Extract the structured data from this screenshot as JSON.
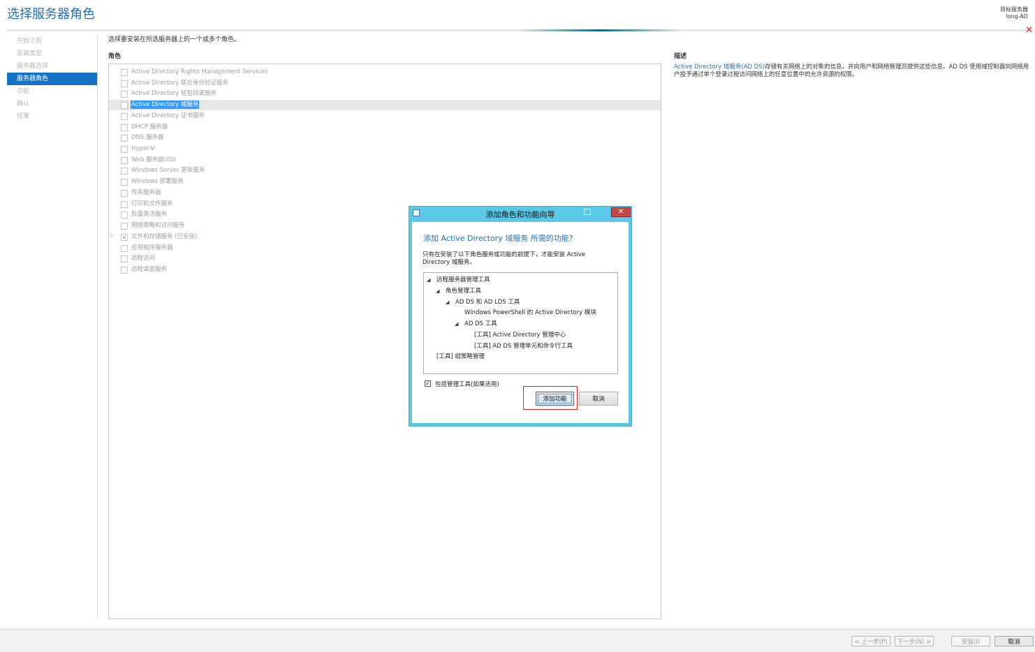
{
  "page": {
    "title": "选择服务器角色",
    "server_label": "目标服务器",
    "server_name": "long-AD",
    "close_glyph": "✕",
    "accent": "#1572c5"
  },
  "nav": {
    "items": [
      {
        "label": "开始之前",
        "active": false
      },
      {
        "label": "安装类型",
        "active": false
      },
      {
        "label": "服务器选择",
        "active": false
      },
      {
        "label": "服务器角色",
        "active": true
      },
      {
        "label": "功能",
        "active": false
      },
      {
        "label": "确认",
        "active": false
      },
      {
        "label": "结果",
        "active": false
      }
    ]
  },
  "main": {
    "instruction": "选择要安装在所选服务器上的一个或多个角色。",
    "roles_header": "角色",
    "roles": [
      "Active Directory Rights Management Services",
      "Active Directory 联合身份验证服务",
      "Active Directory 轻型目录服务",
      "Active Directory 域服务",
      "Active Directory 证书服务",
      "DHCP 服务器",
      "DNS 服务器",
      "Hyper-V",
      "Web 服务器(IIS)",
      "Windows Server 更新服务",
      "Windows 部署服务",
      "传真服务器",
      "打印和文件服务",
      "批量激活服务",
      "网络策略和访问服务",
      "文件和存储服务 (已安装)",
      "应用程序服务器",
      "远程访问",
      "远程桌面服务"
    ],
    "description_header": "描述",
    "description_link": "Active Directory 域服务(AD DS)",
    "description_body": "存储有关网络上的对象的信息，并向用户和网络管理员提供这些信息。AD DS 使用域控制器向网络用户授予通过单个登录过程访问网络上的任意位置中的允许资源的权限。"
  },
  "dialog": {
    "title": "添加角色和功能向导",
    "close_glyph": "✕",
    "header": "添加 Active Directory 域服务 所需的功能?",
    "message": "只有在安装了以下角色服务或功能的前提下，才能安装 Active Directory 域服务。",
    "tree": [
      {
        "label": "远程服务器管理工具"
      },
      {
        "label": "角色管理工具"
      },
      {
        "label": "AD DS 和 AD LDS 工具"
      },
      {
        "label": "Windows PowerShell 的 Active Directory 模块"
      },
      {
        "label": "AD DS 工具"
      },
      {
        "label": "[工具] Active Directory 管理中心"
      },
      {
        "label": "[工具] AD DS 管理单元和命令行工具"
      },
      {
        "label": "[工具] 组策略管理"
      }
    ],
    "include_tools_label": "包括管理工具(如果适用)",
    "include_tools_checked": true,
    "add_button": "添加功能",
    "cancel_button": "取消"
  },
  "footer": {
    "prev": "< 上一步(P)",
    "next": "下一步(N) >",
    "install": "安装(I)",
    "cancel": "取消"
  }
}
